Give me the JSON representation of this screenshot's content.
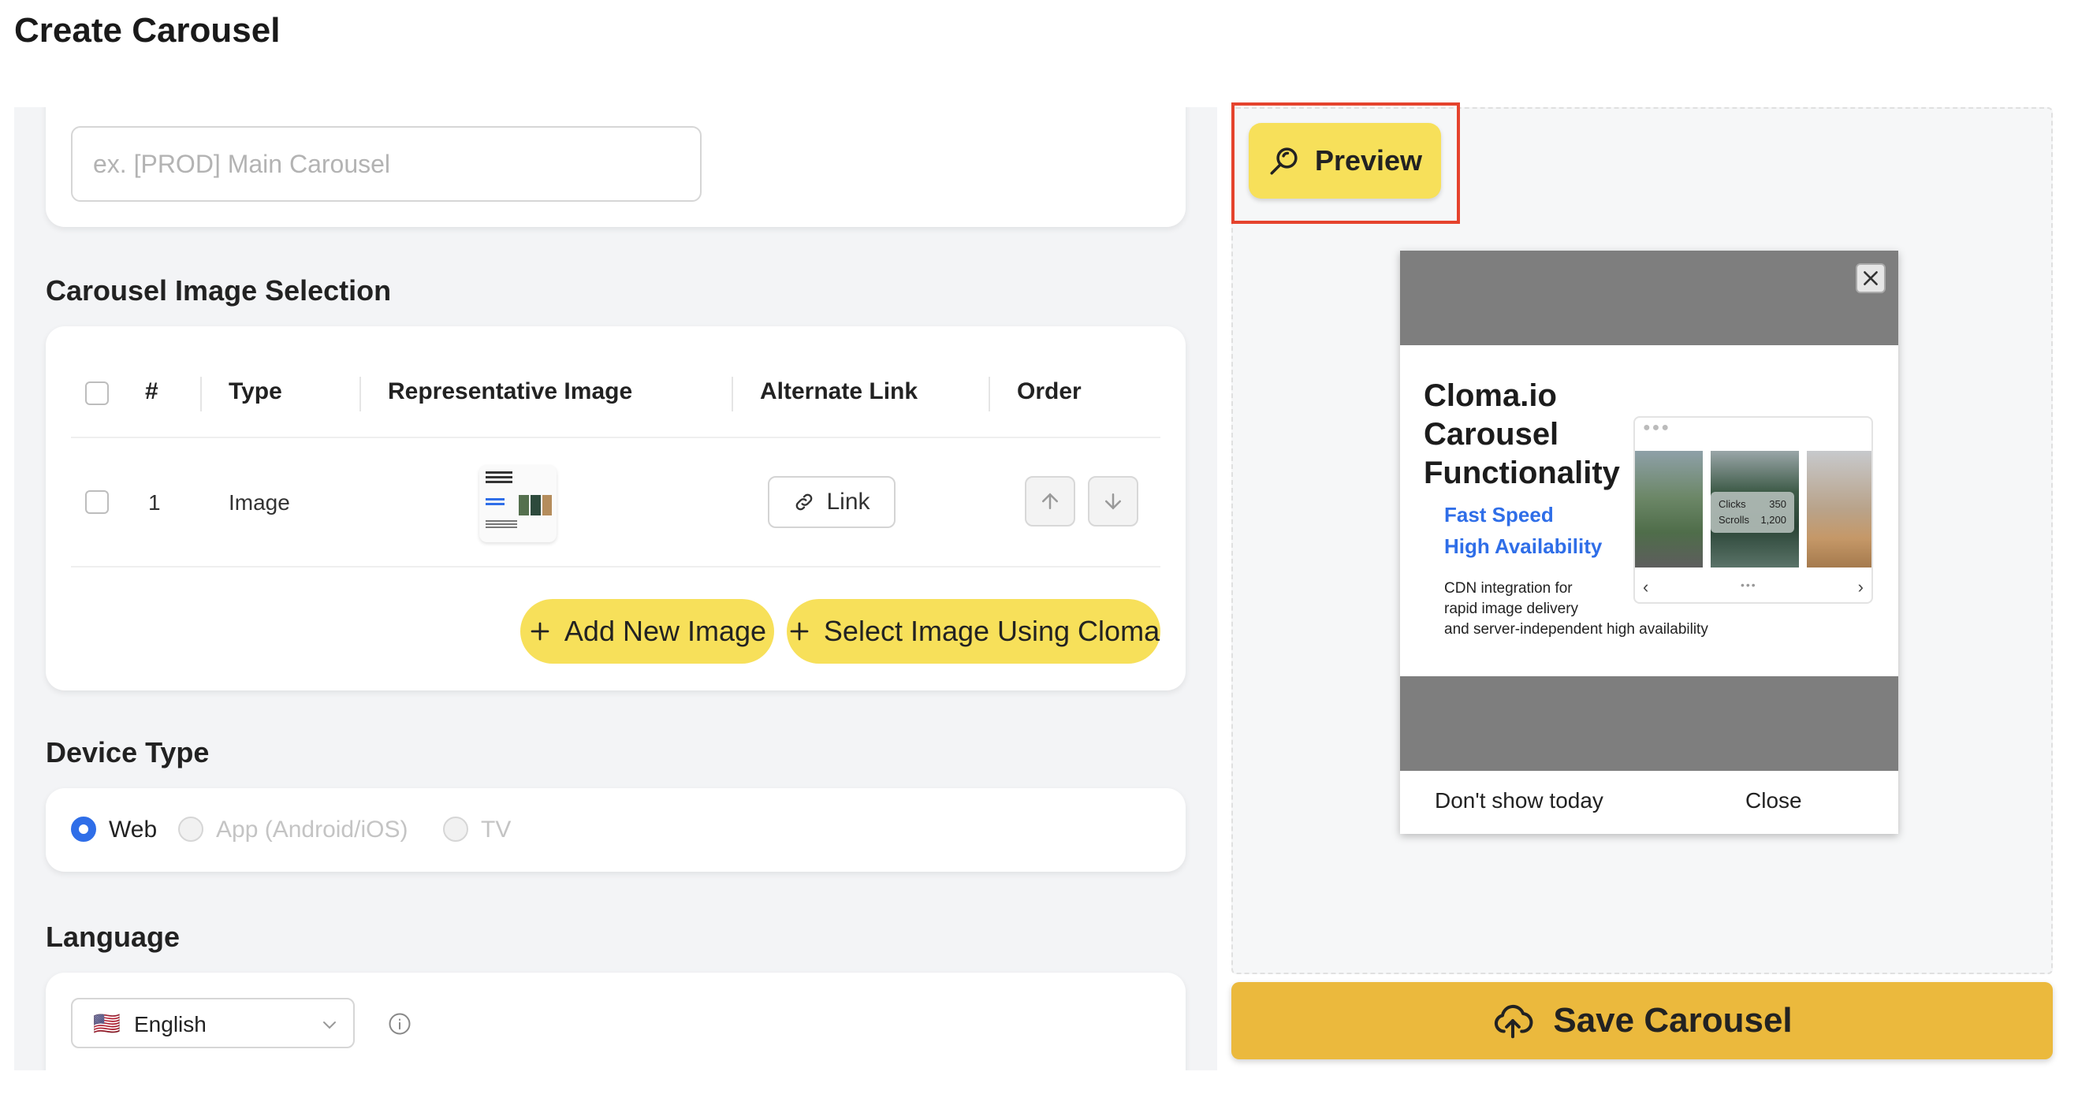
{
  "page": {
    "title": "Create Carousel"
  },
  "name_field": {
    "placeholder": "ex. [PROD] Main Carousel"
  },
  "image_selection": {
    "title": "Carousel Image Selection",
    "headers": {
      "index": "#",
      "type": "Type",
      "image": "Representative Image",
      "link": "Alternate Link",
      "order": "Order"
    },
    "rows": [
      {
        "index": "1",
        "type": "Image",
        "link_label": "Link"
      }
    ],
    "add_new_label": "Add New Image",
    "select_cloma_label": "Select Image Using Cloma"
  },
  "device_type": {
    "title": "Device Type",
    "options": [
      {
        "label": "Web",
        "selected": true
      },
      {
        "label": "App (Android/iOS)",
        "selected": false
      },
      {
        "label": "TV",
        "selected": false
      }
    ]
  },
  "language": {
    "title": "Language",
    "selected": "English",
    "flag": "🇺🇸"
  },
  "preview": {
    "button_label": "Preview",
    "modal": {
      "title_lines": [
        "Cloma.io",
        "Carousel",
        "Functionality"
      ],
      "features": [
        "Fast Speed",
        "High Availability"
      ],
      "description": [
        "CDN integration for",
        "rapid image delivery",
        "and server-independent high availability"
      ],
      "stats": [
        {
          "label": "Clicks",
          "value": "350"
        },
        {
          "label": "Scrolls",
          "value": "1,200"
        }
      ],
      "footer_left": "Don't show today",
      "footer_right": "Close"
    }
  },
  "save_button": {
    "label": "Save Carousel"
  },
  "colors": {
    "accent_yellow": "#f7e05a",
    "save_yellow": "#ebb93d",
    "link_blue": "#2f6ee8",
    "highlight_red": "#e5432d"
  }
}
